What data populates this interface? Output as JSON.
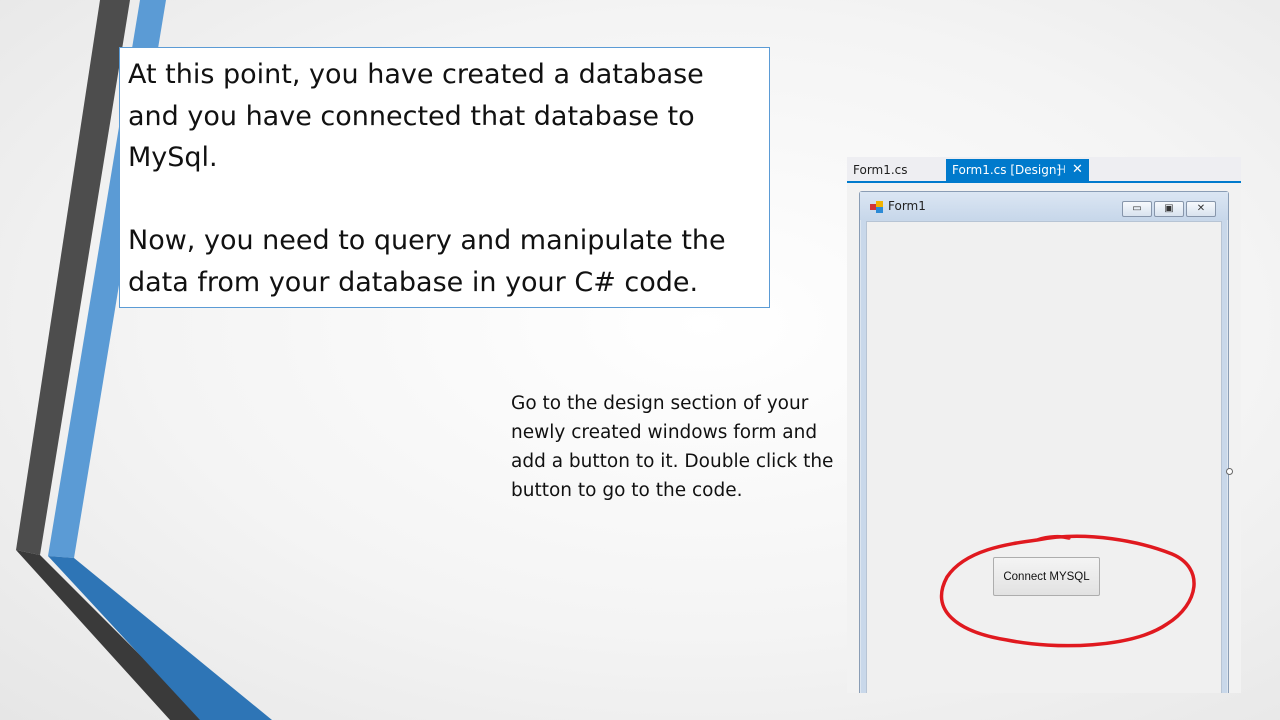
{
  "slide": {
    "callout_text_1": "At this point, you have created a database and you have connected that database to MySql.",
    "callout_text_2": "Now, you need to query and manipulate the data from your database in your C# code.",
    "instructions": "Go to the design section of your newly created windows form and add a button to it. Double click the button to go to the code."
  },
  "ide": {
    "tabs": [
      {
        "label": "Form1.cs",
        "active": false
      },
      {
        "label": "Form1.cs [Design]",
        "active": true
      }
    ],
    "pin_icon": "pin-icon",
    "close_icon": "close-icon"
  },
  "form": {
    "title": "Form1",
    "button_label": "Connect MYSQL",
    "caption_buttons": [
      "minimize-icon",
      "maximize-icon",
      "close-icon"
    ]
  },
  "colors": {
    "accent_blue": "#5b9bd5",
    "dark_gray": "#404040",
    "vs_blue": "#007acc",
    "highlight_red": "#e0191f"
  }
}
